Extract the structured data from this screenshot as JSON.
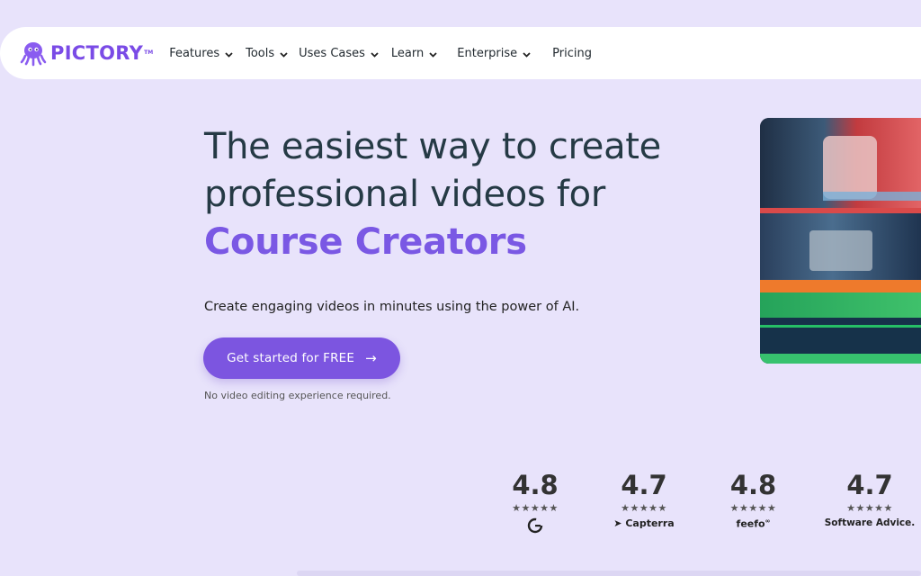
{
  "brand": {
    "name": "PICTORY",
    "tm": "TM",
    "color": "#7a4be6"
  },
  "nav": {
    "items": [
      {
        "label": "Features",
        "has_dropdown": true
      },
      {
        "label": "Tools",
        "has_dropdown": true
      },
      {
        "label": "Uses Cases",
        "has_dropdown": true
      },
      {
        "label": "Learn",
        "has_dropdown": true
      },
      {
        "label": "Enterprise",
        "has_dropdown": true
      },
      {
        "label": "Pricing",
        "has_dropdown": false
      }
    ]
  },
  "hero": {
    "title_line1": "The easiest way to create",
    "title_line2": "professional videos for",
    "title_accent": "Course Creators",
    "subtitle": "Create engaging videos in minutes using the power of AI.",
    "cta_label": "Get started for FREE",
    "cta_icon": "arrow-right-icon",
    "note": "No video editing experience required."
  },
  "ratings": [
    {
      "score": "4.8",
      "stars": "★★★★★",
      "source": "G2",
      "icon": "g2-logo"
    },
    {
      "score": "4.7",
      "stars": "★★★★★",
      "source": "Capterra",
      "icon": "capterra-logo"
    },
    {
      "score": "4.8",
      "stars": "★★★★★",
      "source": "feefo",
      "icon": "feefo-logo"
    },
    {
      "score": "4.7",
      "stars": "★★★★★",
      "source": "Software Advice.",
      "icon": "software-advice-logo"
    }
  ],
  "colors": {
    "background": "#e8e3fb",
    "accent": "#7a58e4",
    "cta": "#7c55e0",
    "heading": "#253a45"
  }
}
